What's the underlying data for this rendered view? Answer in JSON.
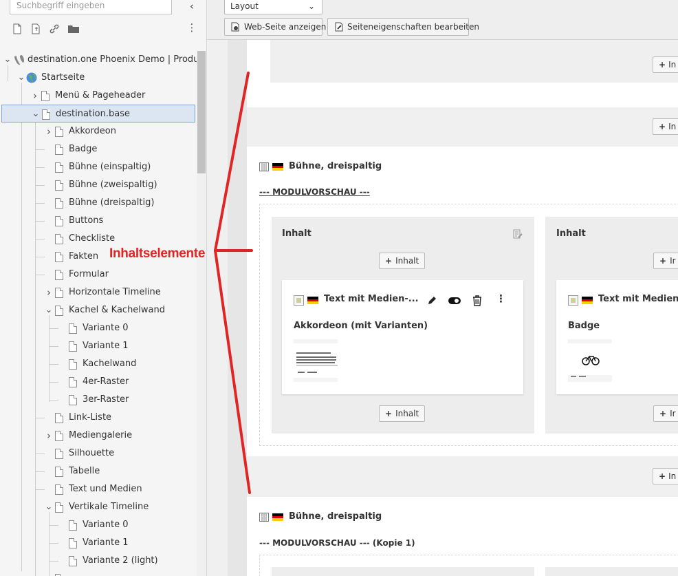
{
  "sidebar": {
    "search_placeholder": "Suchbegriff eingeben",
    "tree": {
      "root": "destination.one Phoenix Demo | Product",
      "start": "Startseite",
      "menu": "Menü & Pageheader",
      "base": "destination.base",
      "items": [
        "Akkordeon",
        "Badge",
        "Bühne (einspaltig)",
        "Bühne (zweispaltig)",
        "Bühne (dreispaltig)",
        "Buttons",
        "Checkliste",
        "Fakten",
        "Formular",
        "Horizontale Timeline",
        "Kachel & Kachelwand"
      ],
      "kachel_children": [
        "Variante 0",
        "Variante 1",
        "Kachelwand",
        "4er-Raster",
        "3er-Raster"
      ],
      "items2": [
        "Link-Liste",
        "Mediengalerie",
        "Silhouette",
        "Tabelle",
        "Text und Medien",
        "Vertikale Timeline"
      ],
      "vert_children": [
        "Variante 0",
        "Variante 1",
        "Variante 2 (light)"
      ]
    }
  },
  "toolbar": {
    "layout_label": "Layout",
    "view_button": "Web-Seite anzeigen",
    "props_button": "Seiteneigenschaften bearbeiten"
  },
  "content": {
    "add_label": "Inhalt",
    "add_label_cut": "In",
    "col_add_cut": "Ir",
    "block1_title": "Bühne, dreispaltig",
    "block1_preview": "--- MODULVORSCHAU ---",
    "col_header": "Inhalt",
    "card_title": "Text mit Medien-...",
    "card_title_cut": "Text mit Medien-.",
    "card1_body": "Akkordeon (mit Varianten)",
    "card2_body": "Badge",
    "block2_title": "Bühne, dreispaltig",
    "block2_preview": "--- MODULVORSCHAU --- (Kopie 1)"
  },
  "annotation": {
    "label": "Inhaltselemente",
    "color": "#e02525"
  }
}
